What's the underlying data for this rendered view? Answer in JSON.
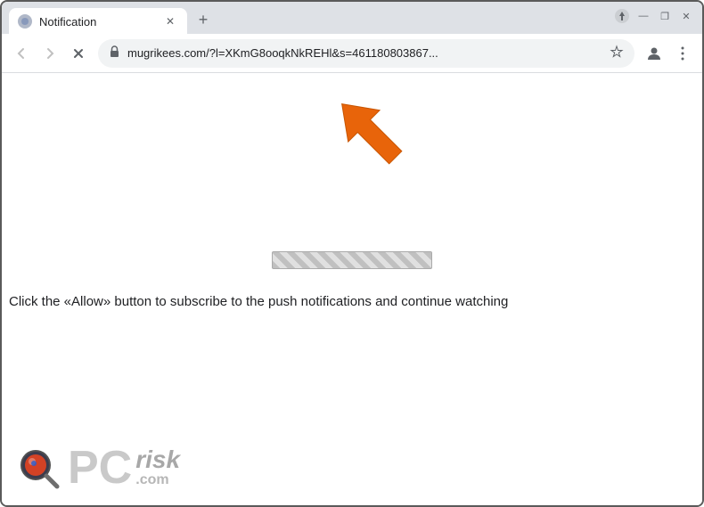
{
  "browser": {
    "tab": {
      "title": "Notification",
      "favicon_color": "#aaaaaa"
    },
    "new_tab_label": "+",
    "window_controls": {
      "minimize": "—",
      "maximize": "❐",
      "close": "✕"
    },
    "nav": {
      "back_disabled": true,
      "forward_disabled": true,
      "reload_label": "✕",
      "url": "mugrikees.com/?l=XKmG8ooqkNkREHl&s=461180803867...",
      "lock_icon": "🔒",
      "star_icon": "☆"
    }
  },
  "page": {
    "instruction_text": "Click the «Allow» button to subscribe to the push notifications and continue watching",
    "progress_bar_visible": true
  },
  "watermark": {
    "pc": "PC",
    "risk": "risk",
    "com": ".com"
  }
}
